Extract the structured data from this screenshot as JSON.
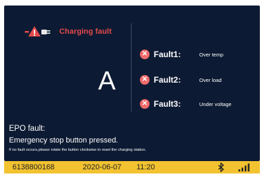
{
  "header": {
    "icon": "charging-gun-warning-icon",
    "title": "Charging fault",
    "title_color": "#e54b4b"
  },
  "gun": {
    "letter": "A"
  },
  "faults": [
    {
      "label": "Fault1:",
      "value": "Over temp",
      "icon": "error-x-icon"
    },
    {
      "label": "Fault2:",
      "value": "Over load",
      "icon": "error-x-icon"
    },
    {
      "label": "Fault3:",
      "value": "Under voltage",
      "icon": "error-x-icon"
    }
  ],
  "epo": {
    "title": "EPO fault:",
    "message": "Emergency stop button pressed.",
    "hint": "If no fault occurs,please rotate the button clockwise to reset the charging station."
  },
  "status_bar": {
    "id": "6138800168",
    "date": "2020-06-07",
    "time": "11:20",
    "bluetooth_icon": "bluetooth-icon",
    "signal_icon": "signal-strength-icon",
    "background": "#f2c230"
  },
  "colors": {
    "panel_bg": "#0d1a33",
    "error_icon": "#f06b6b"
  }
}
